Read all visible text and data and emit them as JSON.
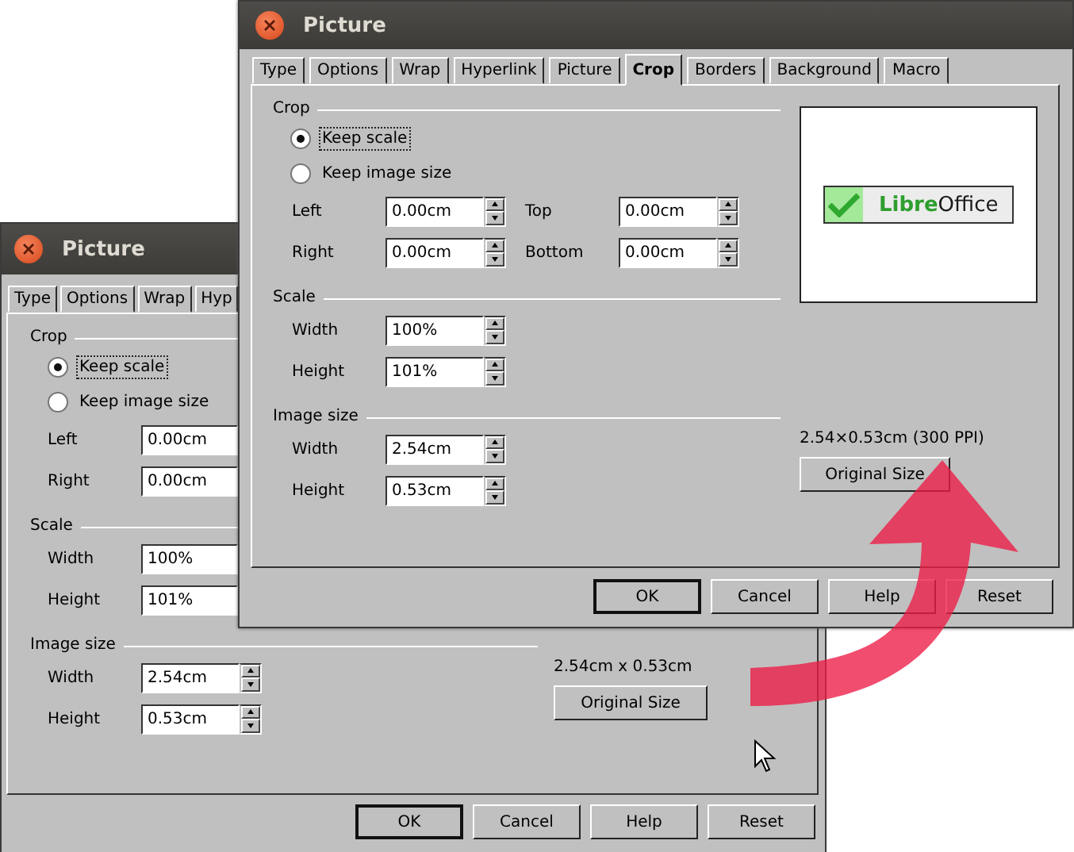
{
  "front_window": {
    "title": "Picture",
    "tabs": [
      {
        "label": "Type",
        "selected": false
      },
      {
        "label": "Options",
        "selected": false
      },
      {
        "label": "Wrap",
        "selected": false
      },
      {
        "label": "Hyperlink",
        "selected": false
      },
      {
        "label": "Picture",
        "selected": false
      },
      {
        "label": "Crop",
        "selected": true
      },
      {
        "label": "Borders",
        "selected": false
      },
      {
        "label": "Background",
        "selected": false
      },
      {
        "label": "Macro",
        "selected": false
      }
    ],
    "crop": {
      "heading": "Crop",
      "options": [
        {
          "label": "Keep scale",
          "selected": true,
          "focused": true
        },
        {
          "label": "Keep image size",
          "selected": false,
          "focused": false
        }
      ],
      "fields": [
        {
          "label": "Left",
          "value": "0.00cm",
          "spinner": true
        },
        {
          "label": "Top",
          "value": "0.00cm",
          "spinner": true
        },
        {
          "label": "Right",
          "value": "0.00cm",
          "spinner": true
        },
        {
          "label": "Bottom",
          "value": "0.00cm",
          "spinner": true
        }
      ]
    },
    "scale": {
      "heading": "Scale",
      "fields": [
        {
          "label": "Width",
          "value": "100%",
          "spinner": true
        },
        {
          "label": "Height",
          "value": "101%",
          "spinner": true
        }
      ]
    },
    "image_size": {
      "heading": "Image size",
      "fields": [
        {
          "label": "Width",
          "value": "2.54cm",
          "spinner": true
        },
        {
          "label": "Height",
          "value": "0.53cm",
          "spinner": true
        }
      ]
    },
    "preview": {
      "logo": {
        "accent": "Libre",
        "rest": "Office"
      }
    },
    "size_info": "2.54×0.53cm (300 PPI)",
    "original_size_button": "Original Size",
    "buttons": [
      {
        "label": "OK",
        "default": true
      },
      {
        "label": "Cancel",
        "default": false
      },
      {
        "label": "Help",
        "default": false
      },
      {
        "label": "Reset",
        "default": false
      }
    ]
  },
  "back_window": {
    "title": "Picture",
    "tabs": [
      {
        "label": "Type",
        "selected": false
      },
      {
        "label": "Options",
        "selected": false
      },
      {
        "label": "Wrap",
        "selected": false
      },
      {
        "label": "Hyp",
        "selected": false
      }
    ],
    "crop": {
      "heading": "Crop",
      "options": [
        {
          "label": "Keep scale",
          "selected": true,
          "focused": true
        },
        {
          "label": "Keep image size",
          "selected": false,
          "focused": false
        }
      ],
      "fields": [
        {
          "label": "Left",
          "value": "0.00cm",
          "spinner": false
        },
        {
          "label": "Right",
          "value": "0.00cm",
          "spinner": false
        }
      ]
    },
    "scale": {
      "heading": "Scale",
      "fields": [
        {
          "label": "Width",
          "value": "100%",
          "spinner": false
        },
        {
          "label": "Height",
          "value": "101%",
          "spinner": false
        }
      ]
    },
    "image_size": {
      "heading": "Image size",
      "fields": [
        {
          "label": "Width",
          "value": "2.54cm",
          "spinner": true
        },
        {
          "label": "Height",
          "value": "0.53cm",
          "spinner": true
        }
      ]
    },
    "size_info": "2.54cm x 0.53cm",
    "original_size_button": "Original Size",
    "buttons": [
      {
        "label": "OK",
        "default": true
      },
      {
        "label": "Cancel",
        "default": false
      },
      {
        "label": "Help",
        "default": false
      },
      {
        "label": "Reset",
        "default": false
      }
    ]
  }
}
